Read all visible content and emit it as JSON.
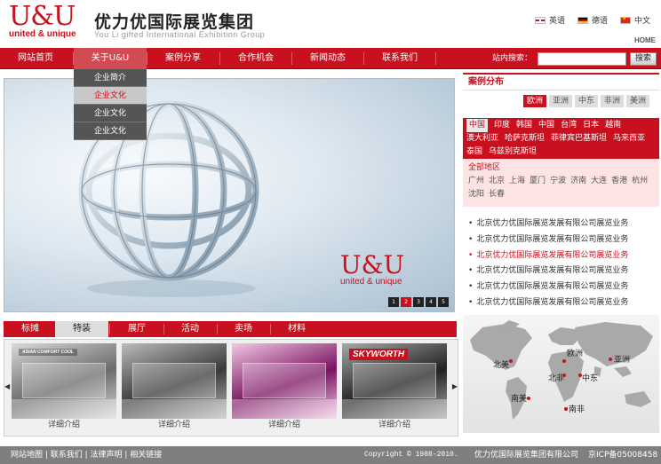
{
  "header": {
    "logo_mark": "U&U",
    "logo_sub": "united & unique",
    "cn_name": "优力优国际展览集团",
    "en_name": "You Li gifted International Exhibition Group",
    "langs": [
      "英语",
      "德语",
      "中文"
    ],
    "home": "HOME"
  },
  "nav": {
    "items": [
      "网站首页",
      "关于U&U",
      "案例分享",
      "合作机会",
      "新闻动态",
      "联系我们"
    ],
    "search_label": "站内搜索：",
    "search_placeholder": "",
    "search_button": "搜索"
  },
  "dropdown": {
    "items": [
      "企业简介",
      "企业文化",
      "企业文化",
      "企业文化"
    ],
    "active_index": 1
  },
  "hero": {
    "logo_mark": "U&U",
    "logo_sub": "united & unique",
    "pages": [
      "1",
      "2",
      "3",
      "4",
      "5"
    ],
    "active_page": 2
  },
  "categories": {
    "tabs": [
      "标摊",
      "特装",
      "展厅",
      "活动",
      "卖场",
      "材料"
    ],
    "active_index": 1
  },
  "thumbs": {
    "items": [
      {
        "caption": "详细介绍",
        "sign": "ASIAN COMFORT COOL",
        "colors": [
          "#6b6b6b",
          "#d9d9d9"
        ]
      },
      {
        "caption": "详细介绍",
        "sign": "",
        "colors": [
          "#3a3a3a",
          "#bbbbbb"
        ]
      },
      {
        "caption": "详细介绍",
        "sign": "",
        "colors": [
          "#7a1460",
          "#f2c9e4"
        ]
      },
      {
        "caption": "详细介绍",
        "sign": "SKYWORTH",
        "colors": [
          "#222222",
          "#a8a8a8"
        ]
      }
    ]
  },
  "cases": {
    "title": "案例分布",
    "regions": [
      "欧洲",
      "亚洲",
      "中东",
      "非洲",
      "美洲"
    ],
    "active_region": 0,
    "countries": [
      "中国",
      "印度",
      "韩国",
      "中国",
      "台湾",
      "日本",
      "越南",
      "澳大利亚",
      "哈萨克斯坦",
      "菲律宾巴基斯坦",
      "马来西亚",
      "泰国",
      "乌兹别克斯坦"
    ],
    "active_country": 0,
    "cities_label": "全部地区",
    "cities": [
      "广州",
      "北京",
      "上海",
      "厦门",
      "宁波",
      "济南",
      "大连",
      "香港",
      "杭州",
      "沈阳",
      "长春"
    ]
  },
  "news": {
    "items": [
      "北京优力优国际展览发展有限公司展览业务",
      "北京优力优国际展览发展有限公司展览业务",
      "北京优力优国际展览发展有限公司展览业务",
      "北京优力优国际展览发展有限公司展览业务",
      "北京优力优国际展览发展有限公司展览业务",
      "北京优力优国际展览发展有限公司展览业务"
    ],
    "active_index": 2
  },
  "map": {
    "labels": [
      "欧洲",
      "亚洲",
      "北美",
      "北非",
      "中东",
      "南美",
      "南非"
    ]
  },
  "footer": {
    "links": "网站地图  |  联系我们  |  法律声明  |  相关链接",
    "copyright": "Copyright © 1988-2010.",
    "company": "优力优国际展览集团有限公司",
    "icp": "京ICP备05008458"
  },
  "colors": {
    "brand_red": "#c8101e",
    "footer_gray": "#7f7f7f"
  }
}
